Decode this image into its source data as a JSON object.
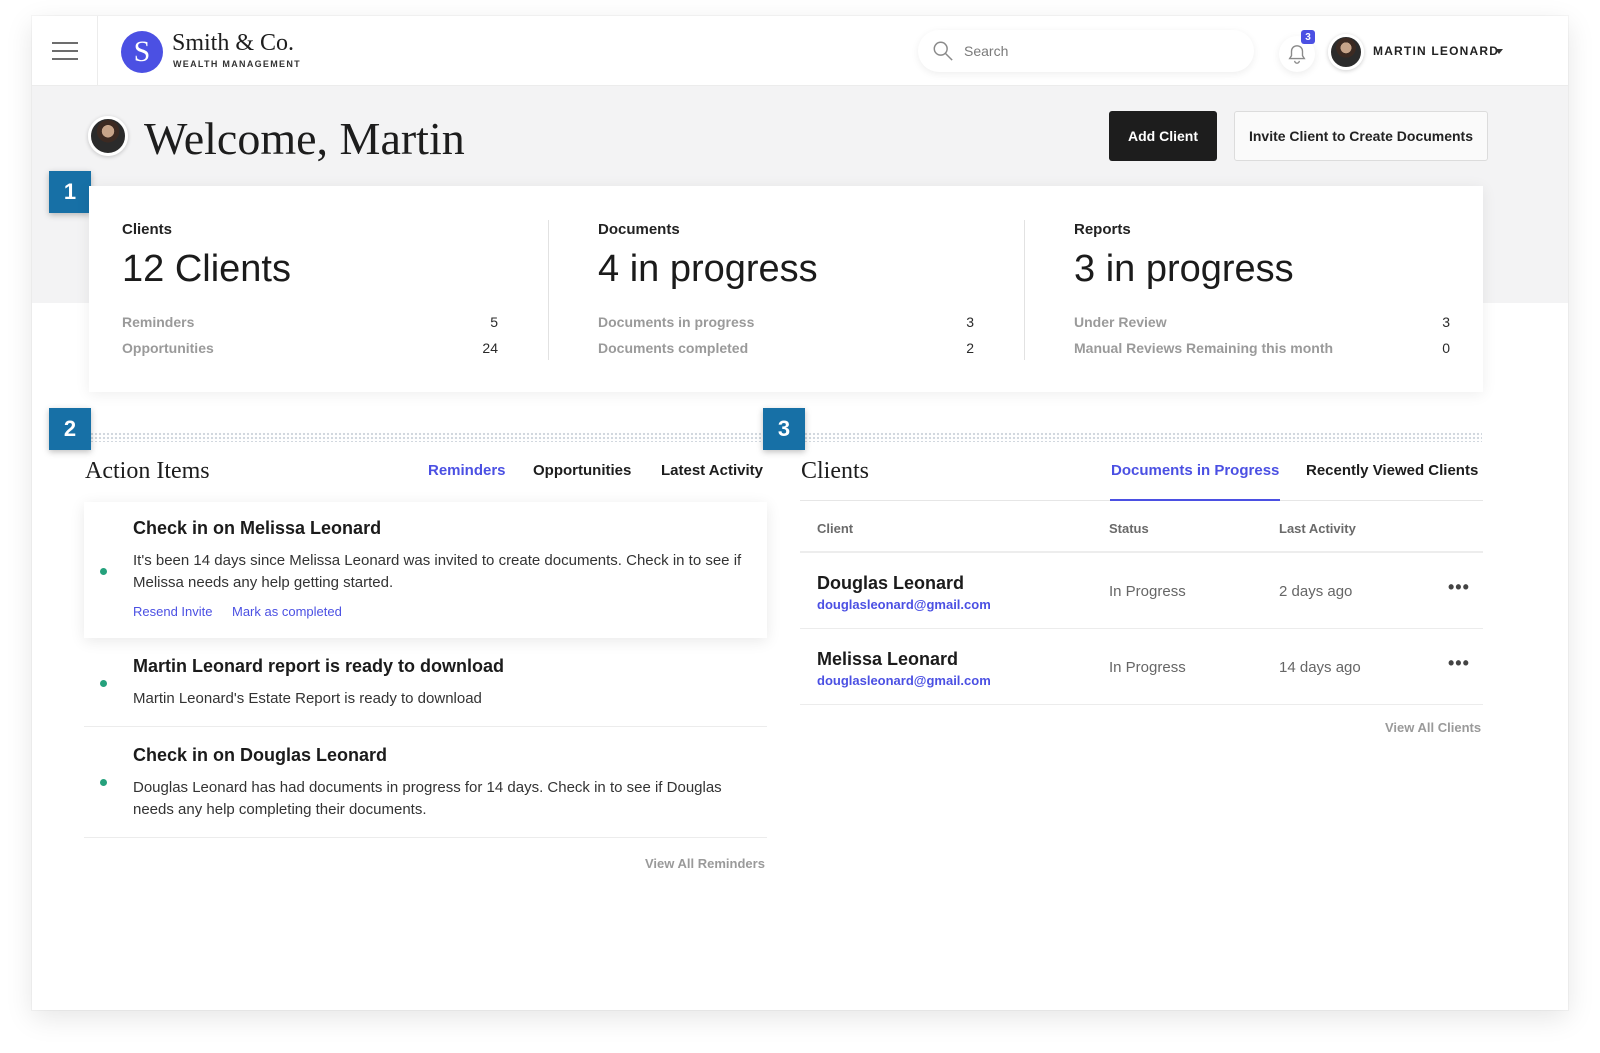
{
  "header": {
    "logo_letter": "S",
    "brand_name": "Smith & Co.",
    "brand_sub": "WEALTH MANAGEMENT",
    "search_placeholder": "Search",
    "notification_count": "3",
    "user_name": "MARTIN LEONARD"
  },
  "welcome": {
    "title": "Welcome, Martin",
    "add_client_label": "Add Client",
    "invite_label": "Invite Client to Create Documents"
  },
  "markers": [
    "1",
    "2",
    "3"
  ],
  "stats": [
    {
      "label": "Clients",
      "big": "12 Clients",
      "rows": [
        {
          "label": "Reminders",
          "value": "5"
        },
        {
          "label": "Opportunities",
          "value": "24"
        }
      ]
    },
    {
      "label": "Documents",
      "big": "4 in progress",
      "rows": [
        {
          "label": "Documents in progress",
          "value": "3"
        },
        {
          "label": "Documents completed",
          "value": "2"
        }
      ]
    },
    {
      "label": "Reports",
      "big": "3 in progress",
      "rows": [
        {
          "label": "Under Review",
          "value": "3"
        },
        {
          "label": "Manual Reviews Remaining this month",
          "value": "0"
        }
      ]
    }
  ],
  "action_items": {
    "title": "Action Items",
    "tabs": [
      "Reminders",
      "Opportunities",
      "Latest Activity"
    ],
    "items": [
      {
        "title": "Check in on Melissa Leonard",
        "body": "It's been 14 days since Melissa Leonard was invited to create documents. Check in to see if Melissa needs any help getting started.",
        "links": [
          "Resend Invite",
          "Mark as completed"
        ]
      },
      {
        "title": "Martin Leonard report is ready to download",
        "body": "Martin Leonard's Estate Report is ready to download"
      },
      {
        "title": "Check in on Douglas Leonard",
        "body": "Douglas Leonard has had documents in progress for 14 days. Check in to see if Douglas needs any help completing their documents."
      }
    ],
    "view_all": "View All Reminders"
  },
  "clients": {
    "title": "Clients",
    "tabs": [
      "Documents in Progress",
      "Recently Viewed Clients"
    ],
    "columns": [
      "Client",
      "Status",
      "Last Activity"
    ],
    "rows": [
      {
        "name": "Douglas Leonard",
        "email": "douglasleonard@gmail.com",
        "status": "In Progress",
        "last": "2 days ago"
      },
      {
        "name": "Melissa Leonard",
        "email": "douglasleonard@gmail.com",
        "status": "In Progress",
        "last": "14 days ago"
      }
    ],
    "more_glyph": "•••",
    "view_all": "View All Clients"
  },
  "colors": {
    "accent": "#4b50e3",
    "marker": "#1770a6",
    "dot": "#25a17c",
    "dark_button": "#1d1d1d"
  }
}
